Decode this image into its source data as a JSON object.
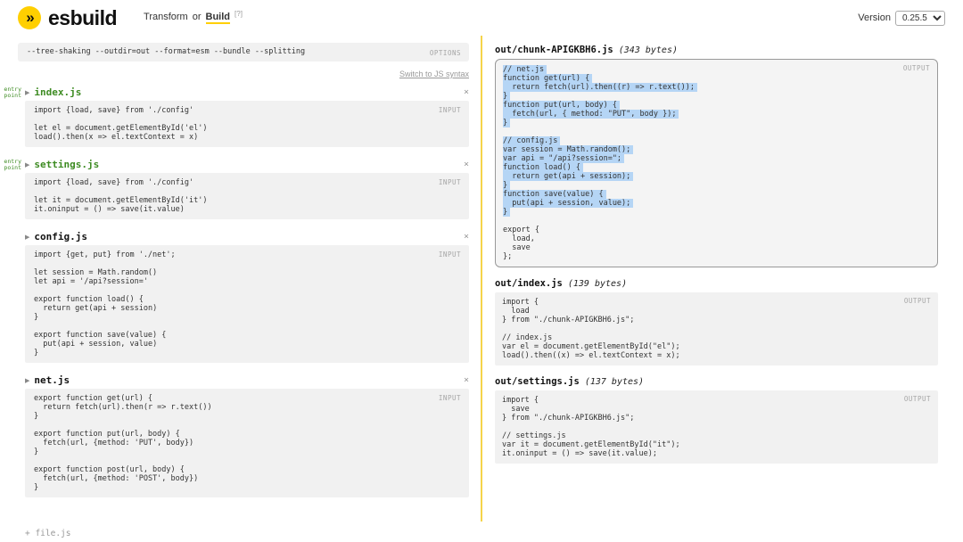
{
  "header": {
    "logo_text": "esbuild",
    "nav_transform": "Transform",
    "nav_or": "or",
    "nav_build": "Build",
    "nav_help": "[?]",
    "version_label": "Version",
    "version_value": "0.25.5"
  },
  "icons": {
    "logo_chevrons": "»",
    "collapse": "▶",
    "close": "×"
  },
  "colors": {
    "brand_yellow": "#ffcf00",
    "divider_yellow": "#f5d44a",
    "entry_green": "#3d8b22",
    "selection_blue": "#b5d5f5"
  },
  "left": {
    "options_value": "--tree-shaking --outdir=out --format=esm --bundle --splitting",
    "options_label": "OPTIONS",
    "switch_link": "Switch to JS syntax",
    "input_label": "INPUT",
    "entry_badge": {
      "line1": "entry",
      "line2": "point"
    },
    "files": [
      {
        "name": "index.js",
        "entry": true,
        "code": "import {load, save} from './config'\n\nlet el = document.getElementById('el')\nload().then(x => el.textContext = x)"
      },
      {
        "name": "settings.js",
        "entry": true,
        "code": "import {load, save} from './config'\n\nlet it = document.getElementById('it')\nit.oninput = () => save(it.value)"
      },
      {
        "name": "config.js",
        "entry": false,
        "code": "import {get, put} from './net';\n\nlet session = Math.random()\nlet api = '/api?session='\n\nexport function load() {\n  return get(api + session)\n}\n\nexport function save(value) {\n  put(api + session, value)\n}"
      },
      {
        "name": "net.js",
        "entry": false,
        "code": "export function get(url) {\n  return fetch(url).then(r => r.text())\n}\n\nexport function put(url, body) {\n  fetch(url, {method: 'PUT', body})\n}\n\nexport function post(url, body) {\n  fetch(url, {method: 'POST', body})\n}"
      }
    ],
    "add_file": "+ file.js"
  },
  "right": {
    "output_label": "OUTPUT",
    "outputs": [
      {
        "name": "out/chunk-APIGKBH6.js",
        "size": "(343 bytes)",
        "lines": [
          {
            "t": "// net.js",
            "hl": true
          },
          {
            "t": "function get(url) {",
            "hl": true
          },
          {
            "t": "  return fetch(url).then((r) => r.text());",
            "hl": true
          },
          {
            "t": "}",
            "hl": true
          },
          {
            "t": "function put(url, body) {",
            "hl": true
          },
          {
            "t": "  fetch(url, { method: \"PUT\", body });",
            "hl": true
          },
          {
            "t": "}",
            "hl": true
          },
          {
            "t": "",
            "hl": false
          },
          {
            "t": "// config.js",
            "hl": true
          },
          {
            "t": "var session = Math.random();",
            "hl": true
          },
          {
            "t": "var api = \"/api?session=\";",
            "hl": true
          },
          {
            "t": "function load() {",
            "hl": true
          },
          {
            "t": "  return get(api + session);",
            "hl": true
          },
          {
            "t": "}",
            "hl": true
          },
          {
            "t": "function save(value) {",
            "hl": true
          },
          {
            "t": "  put(api + session, value);",
            "hl": true
          },
          {
            "t": "}",
            "hl": true
          },
          {
            "t": "",
            "hl": false
          },
          {
            "t": "export {",
            "hl": false
          },
          {
            "t": "  load,",
            "hl": false
          },
          {
            "t": "  save",
            "hl": false
          },
          {
            "t": "};",
            "hl": false
          }
        ]
      },
      {
        "name": "out/index.js",
        "size": "(139 bytes)",
        "lines": [
          {
            "t": "import {",
            "hl": false
          },
          {
            "t": "  load",
            "hl": false
          },
          {
            "t": "} from \"./chunk-APIGKBH6.js\";",
            "hl": false
          },
          {
            "t": "",
            "hl": false
          },
          {
            "t": "// index.js",
            "hl": false
          },
          {
            "t": "var el = document.getElementById(\"el\");",
            "hl": false
          },
          {
            "t": "load().then((x) => el.textContext = x);",
            "hl": false
          }
        ]
      },
      {
        "name": "out/settings.js",
        "size": "(137 bytes)",
        "lines": [
          {
            "t": "import {",
            "hl": false
          },
          {
            "t": "  save",
            "hl": false
          },
          {
            "t": "} from \"./chunk-APIGKBH6.js\";",
            "hl": false
          },
          {
            "t": "",
            "hl": false
          },
          {
            "t": "// settings.js",
            "hl": false
          },
          {
            "t": "var it = document.getElementById(\"it\");",
            "hl": false
          },
          {
            "t": "it.oninput = () => save(it.value);",
            "hl": false
          }
        ]
      }
    ]
  }
}
